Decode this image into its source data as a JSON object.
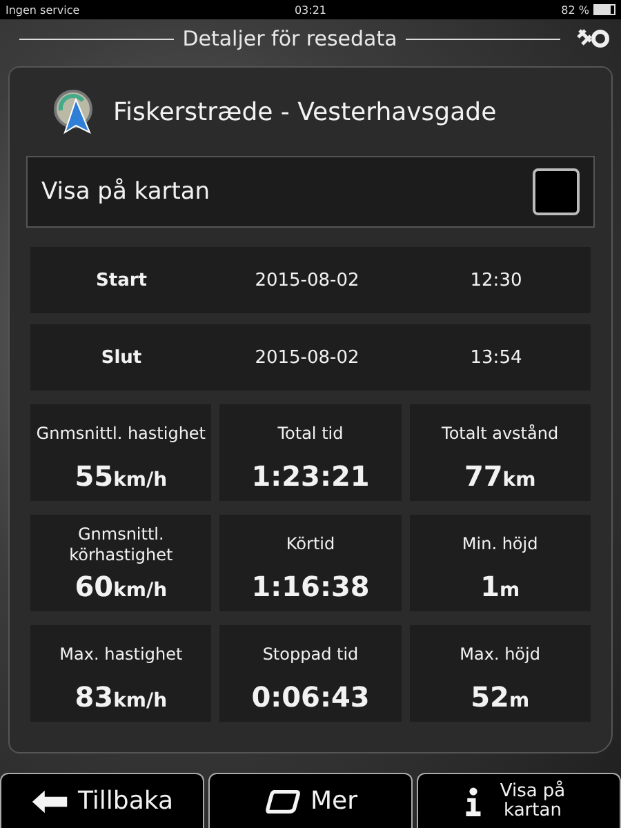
{
  "status_bar": {
    "carrier": "Ingen service",
    "time": "03:21",
    "battery": "82 %"
  },
  "title": "Detaljer för resedata",
  "route": {
    "name": "Fiskerstræde - Vesterhavsgade"
  },
  "show_on_map": {
    "label": "Visa på kartan",
    "checked": false
  },
  "times": [
    {
      "label": "Start",
      "date": "2015-08-02",
      "time": "12:30"
    },
    {
      "label": "Slut",
      "date": "2015-08-02",
      "time": "13:54"
    }
  ],
  "stats": [
    {
      "label": "Gnmsnittl. hastighet",
      "value": "55",
      "unit": "km/h"
    },
    {
      "label": "Total tid",
      "value": "1:23:21"
    },
    {
      "label": "Totalt avstånd",
      "value": "77",
      "unit": "km"
    },
    {
      "label": "Gnmsnittl. körhastighet",
      "value": "60",
      "unit": "km/h"
    },
    {
      "label": "Körtid",
      "value": "1:16:38"
    },
    {
      "label": "Min. höjd",
      "value": "1",
      "unit": "m"
    },
    {
      "label": "Max. hastighet",
      "value": "83",
      "unit": "km/h"
    },
    {
      "label": "Stoppad tid",
      "value": "0:06:43"
    },
    {
      "label": "Max. höjd",
      "value": "52",
      "unit": "m"
    }
  ],
  "buttons": [
    {
      "kind": "back",
      "label": "Tillbaka"
    },
    {
      "kind": "more",
      "label": "Mer"
    },
    {
      "kind": "info",
      "label": "Visa på kartan"
    }
  ]
}
